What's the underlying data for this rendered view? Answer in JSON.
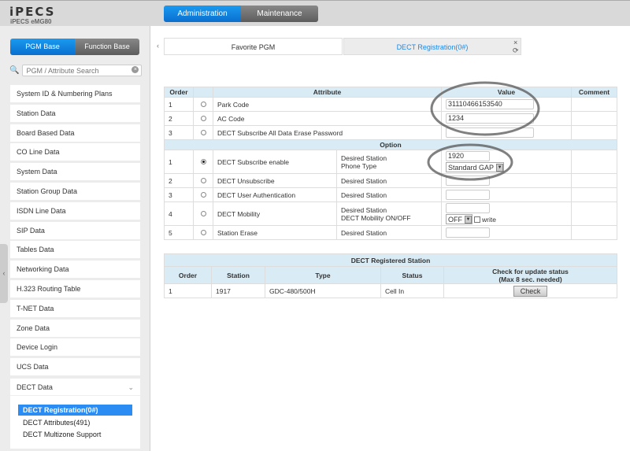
{
  "header": {
    "logo": "iPECS",
    "model": "iPECS eMG80",
    "nav": [
      {
        "label": "Administration",
        "active": true
      },
      {
        "label": "Maintenance",
        "active": false
      }
    ]
  },
  "sidebar": {
    "modes": [
      "PGM Base",
      "Function Base"
    ],
    "search_placeholder": "PGM / Attribute Search",
    "items": [
      "System ID & Numbering Plans",
      "Station Data",
      "Board Based Data",
      "CO Line Data",
      "System Data",
      "Station Group Data",
      "ISDN Line Data",
      "SIP Data",
      "Tables Data",
      "Networking Data",
      "H.323 Routing Table",
      "T-NET Data",
      "Zone Data",
      "Device Login",
      "UCS Data"
    ],
    "expanded": {
      "label": "DECT Data",
      "children": [
        "DECT Registration(0#)",
        "DECT Attributes(491)",
        "DECT Multizone Support"
      ],
      "active": 0
    }
  },
  "tabs": [
    {
      "label": "Favorite PGM"
    },
    {
      "label": "DECT Registration(0#)",
      "active": true
    }
  ],
  "attr_table": {
    "headers": [
      "Order",
      "Attribute",
      "Value",
      "Comment"
    ],
    "rows": [
      {
        "order": "1",
        "attribute": "Park Code",
        "value": "31110466153540"
      },
      {
        "order": "2",
        "attribute": "AC Code",
        "value": "1234"
      },
      {
        "order": "3",
        "attribute": "DECT Subscribe All Data Erase Password",
        "value": ""
      }
    ],
    "option_label": "Option",
    "options": [
      {
        "order": "1",
        "name": "DECT Subscribe enable",
        "checked": true,
        "fields": [
          "Desired Station",
          "Phone Type"
        ],
        "station": "1920",
        "phone_type": "Standard GAP"
      },
      {
        "order": "2",
        "name": "DECT Unsubscribe",
        "fields": [
          "Desired Station"
        ]
      },
      {
        "order": "3",
        "name": "DECT User Authentication",
        "fields": [
          "Desired Station"
        ]
      },
      {
        "order": "4",
        "name": "DECT Mobility",
        "fields": [
          "Desired Station",
          "DECT Mobility ON/OFF"
        ],
        "mobility": "OFF",
        "write_label": "write"
      },
      {
        "order": "5",
        "name": "Station Erase",
        "fields": [
          "Desired Station"
        ]
      }
    ]
  },
  "reg_table": {
    "title": "DECT Registered Station",
    "headers": [
      "Order",
      "Station",
      "Type",
      "Status",
      "Check for update status",
      "(Max 8 sec. needed)"
    ],
    "rows": [
      {
        "order": "1",
        "station": "1917",
        "type": "GDC-480/500H",
        "status": "Cell In"
      }
    ],
    "check_label": "Check"
  }
}
